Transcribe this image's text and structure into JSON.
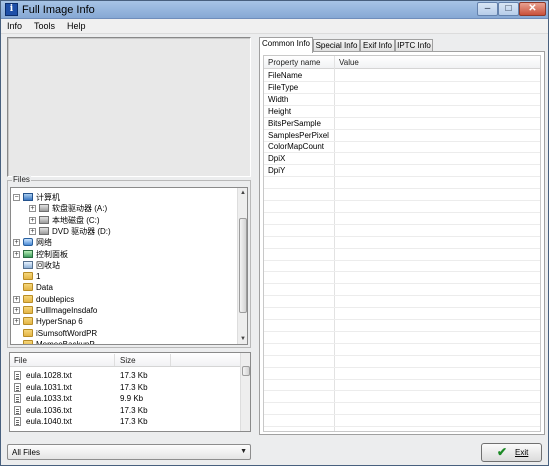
{
  "window": {
    "title": "Full Image Info",
    "app_icon": "info-icon"
  },
  "menu": [
    "Info",
    "Tools",
    "Help"
  ],
  "files_group_label": "Files",
  "tree": [
    {
      "label": "计算机",
      "icon": "computer",
      "expander": "−",
      "indent": 0
    },
    {
      "label": "软盘驱动器 (A:)",
      "icon": "drive",
      "expander": "+",
      "indent": 1
    },
    {
      "label": "本地磁盘 (C:)",
      "icon": "drive",
      "expander": "+",
      "indent": 1
    },
    {
      "label": "DVD 驱动器 (D:)",
      "icon": "drive",
      "expander": "+",
      "indent": 1
    },
    {
      "label": "网络",
      "icon": "network",
      "expander": "+",
      "indent": 0
    },
    {
      "label": "控制面板",
      "icon": "cpanel",
      "expander": "+",
      "indent": 0
    },
    {
      "label": "回收站",
      "icon": "recycle",
      "expander": "",
      "indent": 0
    },
    {
      "label": "1",
      "icon": "folder",
      "expander": "",
      "indent": 0
    },
    {
      "label": "Data",
      "icon": "folder",
      "expander": "",
      "indent": 0
    },
    {
      "label": "doublepics",
      "icon": "folder",
      "expander": "+",
      "indent": 0
    },
    {
      "label": "FullImageInsdafo",
      "icon": "folder",
      "expander": "+",
      "indent": 0
    },
    {
      "label": "HyperSnap 6",
      "icon": "folder",
      "expander": "+",
      "indent": 0
    },
    {
      "label": "iSumsoftWordPR",
      "icon": "folder",
      "expander": "",
      "indent": 0
    },
    {
      "label": "MemeoBackupP",
      "icon": "folder",
      "expander": "",
      "indent": 0
    }
  ],
  "files_table": {
    "columns": [
      "File",
      "Size"
    ],
    "rows": [
      {
        "name": "eula.1028.txt",
        "size": "17.3 Kb"
      },
      {
        "name": "eula.1031.txt",
        "size": "17.3 Kb"
      },
      {
        "name": "eula.1033.txt",
        "size": "9.9 Kb"
      },
      {
        "name": "eula.1036.txt",
        "size": "17.3 Kb"
      },
      {
        "name": "eula.1040.txt",
        "size": "17.3 Kb"
      }
    ]
  },
  "filter": {
    "value": "All Files"
  },
  "tabs": [
    {
      "label": "Common Info",
      "active": true
    },
    {
      "label": "Special Info",
      "active": false
    },
    {
      "label": "Exif Info",
      "active": false
    },
    {
      "label": "IPTC Info",
      "active": false
    }
  ],
  "properties": {
    "columns": [
      "Property name",
      "Value"
    ],
    "rows": [
      {
        "name": "FileName",
        "value": ""
      },
      {
        "name": "FileType",
        "value": ""
      },
      {
        "name": "Width",
        "value": ""
      },
      {
        "name": "Height",
        "value": ""
      },
      {
        "name": "BitsPerSample",
        "value": ""
      },
      {
        "name": "SamplesPerPixel",
        "value": ""
      },
      {
        "name": "ColorMapCount",
        "value": ""
      },
      {
        "name": "DpiX",
        "value": ""
      },
      {
        "name": "DpiY",
        "value": ""
      }
    ]
  },
  "exit_button": {
    "label": "Exit",
    "icon": "check-icon"
  }
}
